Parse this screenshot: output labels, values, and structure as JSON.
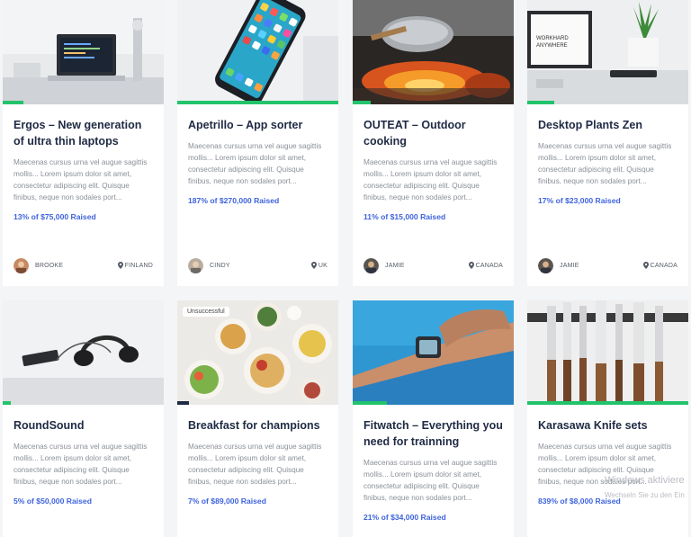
{
  "cards": [
    {
      "title": "Ergos – New generation of ultra thin laptops",
      "description": "Maecenas cursus urna vel augue sagittis mollis... Lorem ipsum dolor sit amet, consectetur adipiscing elit. Quisque finibus, neque non sodales port...",
      "raised": "13% of $75,000 Raised",
      "funded_fraction": 0.13,
      "author": "BROOKE",
      "location": "FINLAND",
      "image": "laptop-desk-photo"
    },
    {
      "title": "Apetrillo – App sorter",
      "description": "Maecenas cursus urna vel augue sagittis mollis... Lorem ipsum dolor sit amet, consectetur adipiscing elit. Quisque finibus, neque non sodales port...",
      "raised": "187% of $270,000 Raised",
      "funded_fraction": 1.0,
      "author": "CINDY",
      "location": "UK",
      "image": "smartphone-photo"
    },
    {
      "title": "OUTEAT – Outdoor cooking",
      "description": "Maecenas cursus urna vel augue sagittis mollis... Lorem ipsum dolor sit amet, consectetur adipiscing elit. Quisque finibus, neque non sodales port...",
      "raised": "11% of $15,000 Raised",
      "funded_fraction": 0.11,
      "author": "JAMIE",
      "location": "CANADA",
      "image": "campfire-pot-photo"
    },
    {
      "title": "Desktop Plants Zen",
      "description": "Maecenas cursus urna vel augue sagittis mollis... Lorem ipsum dolor sit amet, consectetur adipiscing elit. Quisque finibus, neque non sodales port...",
      "raised": "17% of $23,000 Raised",
      "funded_fraction": 0.17,
      "author": "JAMIE",
      "location": "CANADA",
      "image": "desk-plant-photo"
    },
    {
      "title": "RoundSound",
      "description": "Maecenas cursus urna vel augue sagittis mollis... Lorem ipsum dolor sit amet, consectetur adipiscing elit. Quisque finibus, neque non sodales port...",
      "raised": "5% of $50,000 Raised",
      "funded_fraction": 0.05,
      "image": "headphones-photo"
    },
    {
      "title": "Breakfast for champions",
      "description": "Maecenas cursus urna vel augue sagittis mollis... Lorem ipsum dolor sit amet, consectetur adipiscing elit. Quisque finibus, neque non sodales port...",
      "raised": "7% of $89,000 Raised",
      "funded_fraction": 0.07,
      "badge": "Unsuccessful",
      "image": "breakfast-bowls-photo"
    },
    {
      "title": "Fitwatch – Everything you need for trainning",
      "description": "Maecenas cursus urna vel augue sagittis mollis... Lorem ipsum dolor sit amet, consectetur adipiscing elit. Quisque finibus, neque non sodales port...",
      "raised": "21% of $34,000 Raised",
      "funded_fraction": 0.21,
      "image": "smartwatch-photo"
    },
    {
      "title": "Karasawa Knife sets",
      "description": "Maecenas cursus urna vel augue sagittis mollis... Lorem ipsum dolor sit amet, consectetur adipiscing elit. Quisque finibus, neque non sodales port...",
      "raised": "839% of $8,000 Raised",
      "funded_fraction": 1.0,
      "image": "knife-set-photo"
    }
  ],
  "watermark": {
    "line1": "Windows aktiviere",
    "line2": "Wechseln Sie zu den Ein"
  },
  "colors": {
    "progress": "#21c36b",
    "raised_text": "#3d63dd",
    "title_text": "#1f2a44"
  }
}
